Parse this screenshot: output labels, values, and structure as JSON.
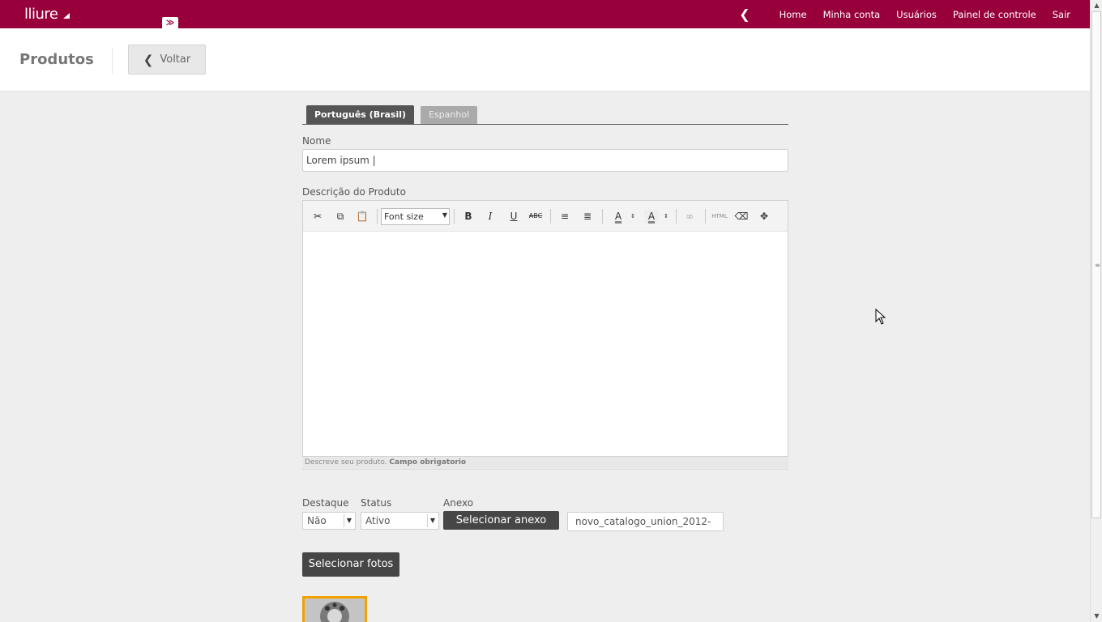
{
  "topbar": {
    "logo": "lliure",
    "nav": [
      "Home",
      "Minha conta",
      "Usuários",
      "Painel de controle",
      "Sair"
    ]
  },
  "header": {
    "title": "Produtos",
    "back_label": "Voltar"
  },
  "tabs": [
    "Português (Brasil)",
    "Espanhol"
  ],
  "form": {
    "nome_label": "Nome",
    "nome_value": "Lorem ipsum |",
    "descricao_label": "Descrição do Produto",
    "font_size_label": "Font size",
    "editor_hint": "Descreve seu produto.",
    "editor_hint_required": "Campo obrigatorio",
    "destaque_label": "Destaque",
    "destaque_value": "Não",
    "status_label": "Status",
    "status_value": "Ativo",
    "anexo_label": "Anexo",
    "anexo_button": "Selecionar anexo",
    "anexo_file": "novo_catalogo_union_2012-",
    "fotos_button": "Selecionar fotos"
  },
  "toolbar_icons": [
    "cut-icon",
    "copy-icon",
    "paste-icon",
    "bold-icon",
    "italic-icon",
    "underline-icon",
    "strikethrough-icon",
    "bullet-list-icon",
    "numbered-list-icon",
    "text-color-icon",
    "background-color-icon",
    "link-icon",
    "html-icon",
    "eraser-icon",
    "fullscreen-icon"
  ],
  "colors": {
    "brand": "#97003a",
    "tab_active": "#555555",
    "thumb_border": "#f2a300"
  }
}
